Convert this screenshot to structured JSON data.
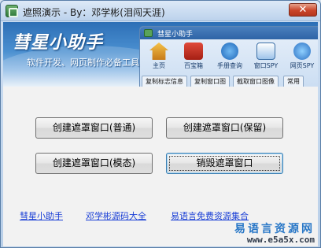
{
  "window": {
    "title": "遮照演示 - By：邓学彬(泪闯天涯)",
    "close_label": "✕"
  },
  "banner": {
    "title": "彗星小助手",
    "subtitle": "软件开发、网页制作必备工具",
    "mini_window": {
      "title": "彗星小助手",
      "tools": [
        {
          "label": "主页",
          "icon": "house-icon"
        },
        {
          "label": "百宝箱",
          "icon": "treasure-box-icon"
        },
        {
          "label": "手册查询",
          "icon": "help-manual-icon"
        },
        {
          "label": "窗口SPY",
          "icon": "window-spy-icon"
        },
        {
          "label": "网页SPY",
          "icon": "web-spy-icon"
        }
      ],
      "tabs": [
        "复制标志信息",
        "复制窗口图",
        "截取窗口图像",
        "常用"
      ]
    }
  },
  "buttons": {
    "normal": "创建遮罩窗口(普通)",
    "keep": "创建遮罩窗口(保留)",
    "modal": "创建遮罩窗口(模态)",
    "destroy": "销毁遮罩窗口"
  },
  "footer": {
    "links": [
      "彗星小助手",
      "邓学彬源码大全",
      "易语言免费资源集合"
    ],
    "watermark_cn": "易语言资源网",
    "watermark_url": "www.e5a5x.com"
  },
  "colors": {
    "link": "#1a3fd6",
    "banner_blue": "#2d6fb6",
    "watermark_blue": "#2a78c7"
  }
}
